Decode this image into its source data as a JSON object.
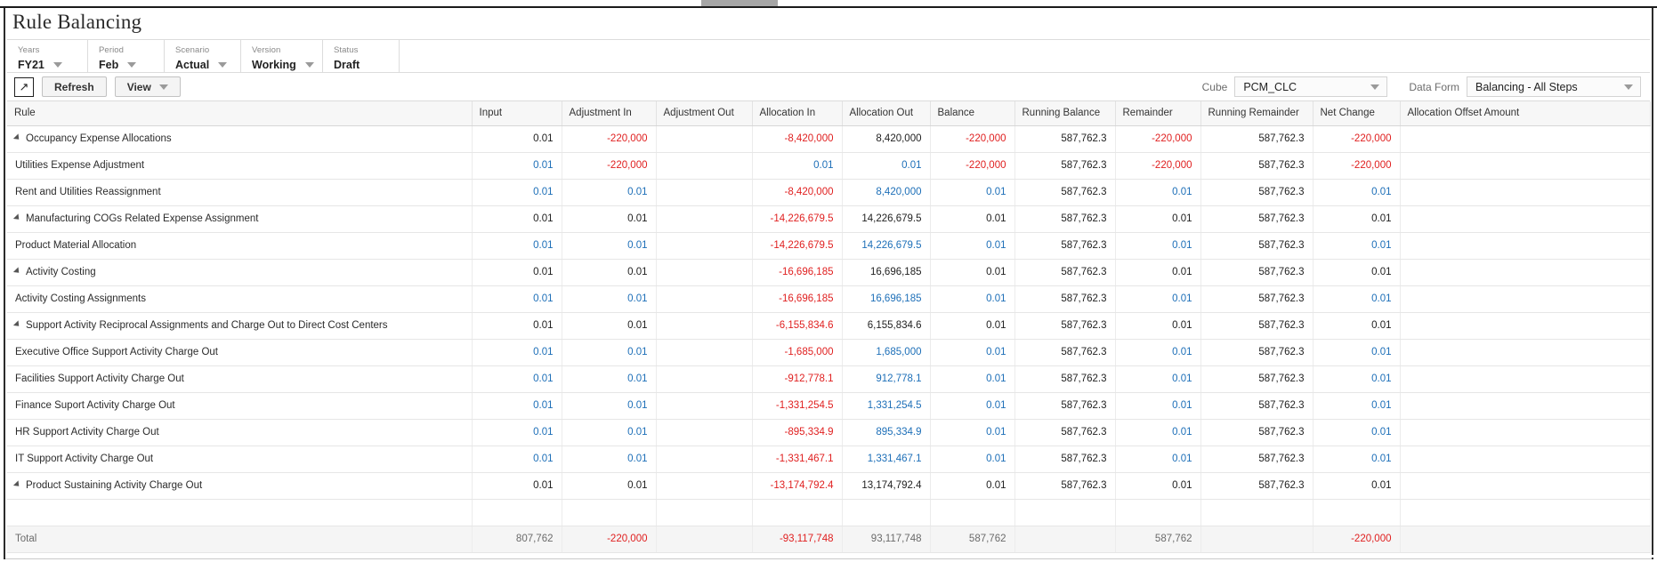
{
  "window": {
    "tab_marker": ""
  },
  "header": {
    "title": "Rule Balancing"
  },
  "pov": {
    "items": [
      {
        "label": "Years",
        "value": "FY21",
        "has_caret": true
      },
      {
        "label": "Period",
        "value": "Feb",
        "has_caret": true
      },
      {
        "label": "Scenario",
        "value": "Actual",
        "has_caret": true
      },
      {
        "label": "Version",
        "value": "Working",
        "has_caret": true
      },
      {
        "label": "Status",
        "value": "Draft",
        "has_caret": false
      }
    ]
  },
  "toolbar": {
    "expand_icon": "↗",
    "refresh_label": "Refresh",
    "view_label": "View",
    "cube_label": "Cube",
    "cube_value": "PCM_CLC",
    "dataform_label": "Data Form",
    "dataform_value": "Balancing - All Steps"
  },
  "colors": {
    "negative": "#e02020",
    "editable": "#1d6fb8",
    "readonly": "#1f1f1f",
    "header_bg": "#f7f7f7",
    "total_bg": "#f5f5f5"
  },
  "grid": {
    "columns": [
      "Rule",
      "Input",
      "Adjustment In",
      "Adjustment Out",
      "Allocation In",
      "Allocation Out",
      "Balance",
      "Running Balance",
      "Remainder",
      "Running Remainder",
      "Net Change",
      "Allocation Offset Amount"
    ],
    "rows": [
      {
        "rule": "Occupancy Expense Allocations",
        "level": 0,
        "expandable": true,
        "cells": [
          {
            "v": "0.01",
            "c": "black"
          },
          {
            "v": "-220,000",
            "c": "red"
          },
          {
            "v": "",
            "c": "black"
          },
          {
            "v": "-8,420,000",
            "c": "red"
          },
          {
            "v": "8,420,000",
            "c": "black"
          },
          {
            "v": "-220,000",
            "c": "red"
          },
          {
            "v": "587,762.3",
            "c": "black"
          },
          {
            "v": "-220,000",
            "c": "red"
          },
          {
            "v": "587,762.3",
            "c": "black"
          },
          {
            "v": "-220,000",
            "c": "red"
          },
          {
            "v": "",
            "c": "black"
          }
        ]
      },
      {
        "rule": "Utilities Expense Adjustment",
        "level": 1,
        "expandable": false,
        "cells": [
          {
            "v": "0.01",
            "c": "blue"
          },
          {
            "v": "-220,000",
            "c": "red"
          },
          {
            "v": "",
            "c": "black"
          },
          {
            "v": "0.01",
            "c": "blue"
          },
          {
            "v": "0.01",
            "c": "blue"
          },
          {
            "v": "-220,000",
            "c": "red"
          },
          {
            "v": "587,762.3",
            "c": "black"
          },
          {
            "v": "-220,000",
            "c": "red"
          },
          {
            "v": "587,762.3",
            "c": "black"
          },
          {
            "v": "-220,000",
            "c": "red"
          },
          {
            "v": "",
            "c": "black"
          }
        ]
      },
      {
        "rule": "Rent and Utilities Reassignment",
        "level": 1,
        "expandable": false,
        "cells": [
          {
            "v": "0.01",
            "c": "blue"
          },
          {
            "v": "0.01",
            "c": "blue"
          },
          {
            "v": "",
            "c": "black"
          },
          {
            "v": "-8,420,000",
            "c": "red"
          },
          {
            "v": "8,420,000",
            "c": "blue"
          },
          {
            "v": "0.01",
            "c": "blue"
          },
          {
            "v": "587,762.3",
            "c": "black"
          },
          {
            "v": "0.01",
            "c": "blue"
          },
          {
            "v": "587,762.3",
            "c": "black"
          },
          {
            "v": "0.01",
            "c": "blue"
          },
          {
            "v": "",
            "c": "black"
          }
        ]
      },
      {
        "rule": "Manufacturing COGs Related Expense Assignment",
        "level": 0,
        "expandable": true,
        "cells": [
          {
            "v": "0.01",
            "c": "black"
          },
          {
            "v": "0.01",
            "c": "black"
          },
          {
            "v": "",
            "c": "black"
          },
          {
            "v": "-14,226,679.5",
            "c": "red"
          },
          {
            "v": "14,226,679.5",
            "c": "black"
          },
          {
            "v": "0.01",
            "c": "black"
          },
          {
            "v": "587,762.3",
            "c": "black"
          },
          {
            "v": "0.01",
            "c": "black"
          },
          {
            "v": "587,762.3",
            "c": "black"
          },
          {
            "v": "0.01",
            "c": "black"
          },
          {
            "v": "",
            "c": "black"
          }
        ]
      },
      {
        "rule": "Product Material Allocation",
        "level": 1,
        "expandable": false,
        "cells": [
          {
            "v": "0.01",
            "c": "blue"
          },
          {
            "v": "0.01",
            "c": "blue"
          },
          {
            "v": "",
            "c": "black"
          },
          {
            "v": "-14,226,679.5",
            "c": "red"
          },
          {
            "v": "14,226,679.5",
            "c": "blue"
          },
          {
            "v": "0.01",
            "c": "blue"
          },
          {
            "v": "587,762.3",
            "c": "black"
          },
          {
            "v": "0.01",
            "c": "blue"
          },
          {
            "v": "587,762.3",
            "c": "black"
          },
          {
            "v": "0.01",
            "c": "blue"
          },
          {
            "v": "",
            "c": "black"
          }
        ]
      },
      {
        "rule": "Activity Costing",
        "level": 0,
        "expandable": true,
        "cells": [
          {
            "v": "0.01",
            "c": "black"
          },
          {
            "v": "0.01",
            "c": "black"
          },
          {
            "v": "",
            "c": "black"
          },
          {
            "v": "-16,696,185",
            "c": "red"
          },
          {
            "v": "16,696,185",
            "c": "black"
          },
          {
            "v": "0.01",
            "c": "black"
          },
          {
            "v": "587,762.3",
            "c": "black"
          },
          {
            "v": "0.01",
            "c": "black"
          },
          {
            "v": "587,762.3",
            "c": "black"
          },
          {
            "v": "0.01",
            "c": "black"
          },
          {
            "v": "",
            "c": "black"
          }
        ]
      },
      {
        "rule": "Activity Costing Assignments",
        "level": 1,
        "expandable": false,
        "cells": [
          {
            "v": "0.01",
            "c": "blue"
          },
          {
            "v": "0.01",
            "c": "blue"
          },
          {
            "v": "",
            "c": "black"
          },
          {
            "v": "-16,696,185",
            "c": "red"
          },
          {
            "v": "16,696,185",
            "c": "blue"
          },
          {
            "v": "0.01",
            "c": "blue"
          },
          {
            "v": "587,762.3",
            "c": "black"
          },
          {
            "v": "0.01",
            "c": "blue"
          },
          {
            "v": "587,762.3",
            "c": "black"
          },
          {
            "v": "0.01",
            "c": "blue"
          },
          {
            "v": "",
            "c": "black"
          }
        ]
      },
      {
        "rule": "Support Activity Reciprocal Assignments and Charge Out to Direct Cost Centers",
        "level": 0,
        "expandable": true,
        "cells": [
          {
            "v": "0.01",
            "c": "black"
          },
          {
            "v": "0.01",
            "c": "black"
          },
          {
            "v": "",
            "c": "black"
          },
          {
            "v": "-6,155,834.6",
            "c": "red"
          },
          {
            "v": "6,155,834.6",
            "c": "black"
          },
          {
            "v": "0.01",
            "c": "black"
          },
          {
            "v": "587,762.3",
            "c": "black"
          },
          {
            "v": "0.01",
            "c": "black"
          },
          {
            "v": "587,762.3",
            "c": "black"
          },
          {
            "v": "0.01",
            "c": "black"
          },
          {
            "v": "",
            "c": "black"
          }
        ]
      },
      {
        "rule": "Executive Office Support Activity Charge Out",
        "level": 1,
        "expandable": false,
        "cells": [
          {
            "v": "0.01",
            "c": "blue"
          },
          {
            "v": "0.01",
            "c": "blue"
          },
          {
            "v": "",
            "c": "black"
          },
          {
            "v": "-1,685,000",
            "c": "red"
          },
          {
            "v": "1,685,000",
            "c": "blue"
          },
          {
            "v": "0.01",
            "c": "blue"
          },
          {
            "v": "587,762.3",
            "c": "black"
          },
          {
            "v": "0.01",
            "c": "blue"
          },
          {
            "v": "587,762.3",
            "c": "black"
          },
          {
            "v": "0.01",
            "c": "blue"
          },
          {
            "v": "",
            "c": "black"
          }
        ]
      },
      {
        "rule": "Facilities Support Activity Charge Out",
        "level": 1,
        "expandable": false,
        "cells": [
          {
            "v": "0.01",
            "c": "blue"
          },
          {
            "v": "0.01",
            "c": "blue"
          },
          {
            "v": "",
            "c": "black"
          },
          {
            "v": "-912,778.1",
            "c": "red"
          },
          {
            "v": "912,778.1",
            "c": "blue"
          },
          {
            "v": "0.01",
            "c": "blue"
          },
          {
            "v": "587,762.3",
            "c": "black"
          },
          {
            "v": "0.01",
            "c": "blue"
          },
          {
            "v": "587,762.3",
            "c": "black"
          },
          {
            "v": "0.01",
            "c": "blue"
          },
          {
            "v": "",
            "c": "black"
          }
        ]
      },
      {
        "rule": "Finance Suport Activity Charge Out",
        "level": 1,
        "expandable": false,
        "cells": [
          {
            "v": "0.01",
            "c": "blue"
          },
          {
            "v": "0.01",
            "c": "blue"
          },
          {
            "v": "",
            "c": "black"
          },
          {
            "v": "-1,331,254.5",
            "c": "red"
          },
          {
            "v": "1,331,254.5",
            "c": "blue"
          },
          {
            "v": "0.01",
            "c": "blue"
          },
          {
            "v": "587,762.3",
            "c": "black"
          },
          {
            "v": "0.01",
            "c": "blue"
          },
          {
            "v": "587,762.3",
            "c": "black"
          },
          {
            "v": "0.01",
            "c": "blue"
          },
          {
            "v": "",
            "c": "black"
          }
        ]
      },
      {
        "rule": "HR Support Activity Charge Out",
        "level": 1,
        "expandable": false,
        "cells": [
          {
            "v": "0.01",
            "c": "blue"
          },
          {
            "v": "0.01",
            "c": "blue"
          },
          {
            "v": "",
            "c": "black"
          },
          {
            "v": "-895,334.9",
            "c": "red"
          },
          {
            "v": "895,334.9",
            "c": "blue"
          },
          {
            "v": "0.01",
            "c": "blue"
          },
          {
            "v": "587,762.3",
            "c": "black"
          },
          {
            "v": "0.01",
            "c": "blue"
          },
          {
            "v": "587,762.3",
            "c": "black"
          },
          {
            "v": "0.01",
            "c": "blue"
          },
          {
            "v": "",
            "c": "black"
          }
        ]
      },
      {
        "rule": "IT Support Activity Charge Out",
        "level": 1,
        "expandable": false,
        "cells": [
          {
            "v": "0.01",
            "c": "blue"
          },
          {
            "v": "0.01",
            "c": "blue"
          },
          {
            "v": "",
            "c": "black"
          },
          {
            "v": "-1,331,467.1",
            "c": "red"
          },
          {
            "v": "1,331,467.1",
            "c": "blue"
          },
          {
            "v": "0.01",
            "c": "blue"
          },
          {
            "v": "587,762.3",
            "c": "black"
          },
          {
            "v": "0.01",
            "c": "blue"
          },
          {
            "v": "587,762.3",
            "c": "black"
          },
          {
            "v": "0.01",
            "c": "blue"
          },
          {
            "v": "",
            "c": "black"
          }
        ]
      },
      {
        "rule": "Product Sustaining Activity Charge Out",
        "level": 0,
        "expandable": true,
        "cells": [
          {
            "v": "0.01",
            "c": "black"
          },
          {
            "v": "0.01",
            "c": "black"
          },
          {
            "v": "",
            "c": "black"
          },
          {
            "v": "-13,174,792.4",
            "c": "red"
          },
          {
            "v": "13,174,792.4",
            "c": "black"
          },
          {
            "v": "0.01",
            "c": "black"
          },
          {
            "v": "587,762.3",
            "c": "black"
          },
          {
            "v": "0.01",
            "c": "black"
          },
          {
            "v": "587,762.3",
            "c": "black"
          },
          {
            "v": "0.01",
            "c": "black"
          },
          {
            "v": "",
            "c": "black"
          }
        ]
      }
    ],
    "total": {
      "label": "Total",
      "cells": [
        {
          "v": "807,762",
          "c": "total"
        },
        {
          "v": "-220,000",
          "c": "red"
        },
        {
          "v": "",
          "c": "total"
        },
        {
          "v": "-93,117,748",
          "c": "red"
        },
        {
          "v": "93,117,748",
          "c": "total"
        },
        {
          "v": "587,762",
          "c": "total"
        },
        {
          "v": "",
          "c": "total"
        },
        {
          "v": "587,762",
          "c": "total"
        },
        {
          "v": "",
          "c": "total"
        },
        {
          "v": "-220,000",
          "c": "red"
        },
        {
          "v": "",
          "c": "total"
        }
      ]
    }
  }
}
